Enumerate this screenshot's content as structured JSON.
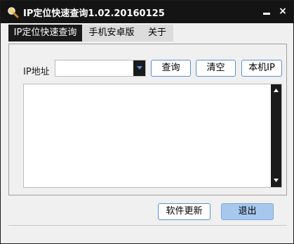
{
  "window": {
    "title": "IP定位快速查询1.02.20160125",
    "minimize_glyph": "_",
    "close_glyph": "×",
    "app_icon": "magnifier-icon"
  },
  "tabs": [
    {
      "label": "IP定位快速查询",
      "active": true
    },
    {
      "label": "手机安卓版",
      "active": false
    },
    {
      "label": "关于",
      "active": false
    }
  ],
  "query": {
    "ip_label": "IP地址",
    "ip_value": "",
    "dropdown_icon": "chevron-down-icon",
    "query_button": "查询",
    "clear_button": "清空",
    "local_ip_button": "本机IP"
  },
  "results": {
    "text": "",
    "scroll_up_icon": "arrow-up-icon",
    "scroll_down_icon": "arrow-down-icon"
  },
  "footer": {
    "update_button": "软件更新",
    "exit_button": "退出"
  },
  "colors": {
    "titlebar": "#141414",
    "accent_border": "#5a8fd0",
    "exit_button_fill": "#a7c8ee",
    "window_bg": "#f0f0f0"
  }
}
